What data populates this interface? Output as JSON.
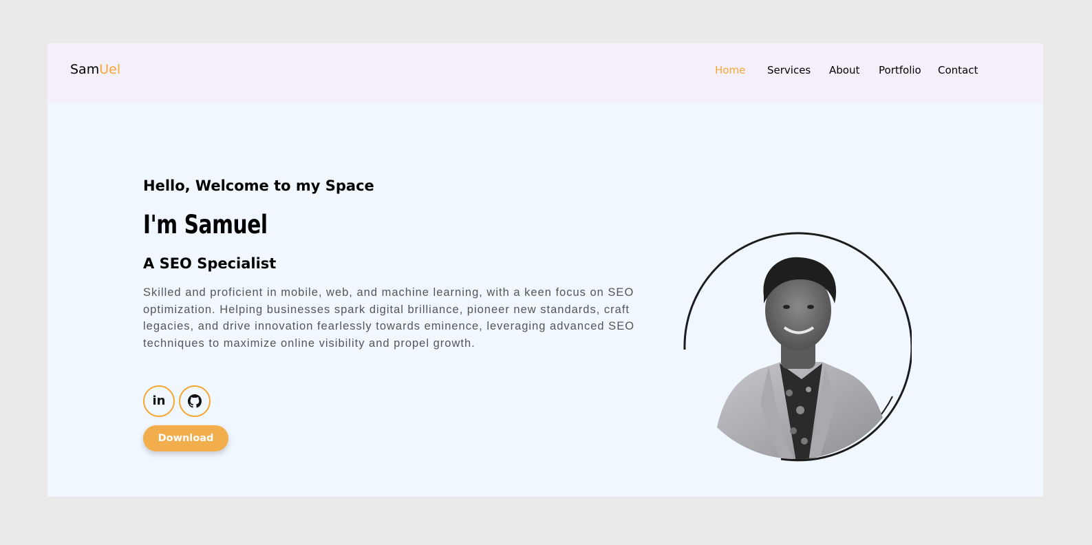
{
  "brand": {
    "first": "Sam",
    "accent": "Uel"
  },
  "nav": {
    "items": [
      {
        "label": "Home",
        "active": true
      },
      {
        "label": "Services",
        "active": false
      },
      {
        "label": "About",
        "active": false
      },
      {
        "label": "Portfolio",
        "active": false
      },
      {
        "label": "Contact",
        "active": false
      }
    ]
  },
  "hero": {
    "greeting": "Hello, Welcome to my Space",
    "name": "I'm Samuel",
    "role": "A SEO Specialist",
    "bio": "Skilled and proficient in mobile, web, and machine learning, with a keen focus on SEO optimization. Helping businesses spark digital brilliance, pioneer new standards, craft legacies, and drive innovation fearlessly towards eminence, leveraging advanced SEO techniques to maximize online visibility and propel growth.",
    "social": [
      {
        "icon": "linkedin-icon",
        "glyph": "in"
      },
      {
        "icon": "github-icon",
        "glyph": ""
      }
    ],
    "download_label": "Download"
  },
  "colors": {
    "accent": "#f6a733",
    "button": "#f2ad4c",
    "hero_bg": "#f0f7fe",
    "nav_bg": "#f4eff9",
    "page_bg": "#eaebe9"
  }
}
